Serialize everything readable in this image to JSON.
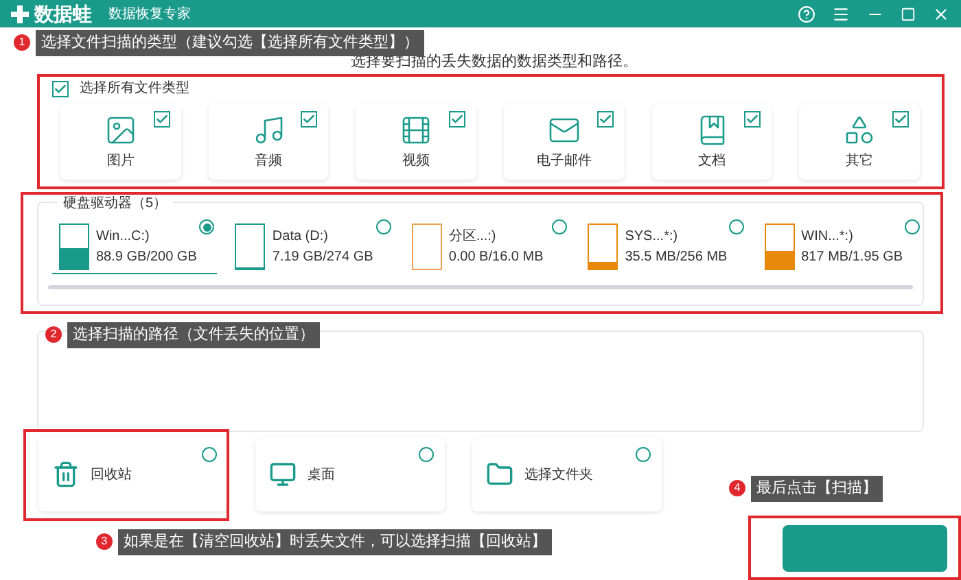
{
  "header": {
    "logo_text": "数据蛙",
    "subtitle": "数据恢复专家"
  },
  "heading": "选择要扫描的丢失数据的数据类型和路径。",
  "select_all": {
    "label": "选择所有文件类型",
    "checked": true
  },
  "file_types": [
    {
      "kind": "image",
      "label": "图片",
      "checked": true
    },
    {
      "kind": "audio",
      "label": "音频",
      "checked": true
    },
    {
      "kind": "video",
      "label": "视频",
      "checked": true
    },
    {
      "kind": "email",
      "label": "电子邮件",
      "checked": true
    },
    {
      "kind": "document",
      "label": "文档",
      "checked": true
    },
    {
      "kind": "other",
      "label": "其它",
      "checked": true
    }
  ],
  "drives": {
    "title": "硬盘驱动器（5）",
    "items": [
      {
        "name": "Win...C:)",
        "size": "88.9 GB/200 GB",
        "level": 0.45,
        "color": "#1a9a8a",
        "selected": true
      },
      {
        "name": "Data (D:)",
        "size": "7.19 GB/274 GB",
        "level": 0.03,
        "color": "#1a9a8a",
        "selected": false
      },
      {
        "name": "分区...:)",
        "size": "0.00  B/16.0 MB",
        "level": 0,
        "color": "#f0a050",
        "selected": false
      },
      {
        "name": "SYS...*:)",
        "size": "35.5 MB/256 MB",
        "level": 0.15,
        "color": "#e8890c",
        "selected": false
      },
      {
        "name": "WIN...*:)",
        "size": "817 MB/1.95 GB",
        "level": 0.42,
        "color": "#e8890c",
        "selected": false
      }
    ]
  },
  "locations": [
    {
      "kind": "recycle",
      "label": "回收站",
      "selected": false
    },
    {
      "kind": "desktop",
      "label": "桌面",
      "selected": false
    },
    {
      "kind": "folder",
      "label": "选择文件夹",
      "selected": false
    }
  ],
  "annotations": [
    {
      "number": "1",
      "text": "选择文件扫描的类型（建议勾选【选择所有文件类型】）"
    },
    {
      "number": "2",
      "text": "选择扫描的路径（文件丢失的位置）"
    },
    {
      "number": "3",
      "text": "如果是在【清空回收站】时丢失文件，可以选择扫描【回收站】"
    },
    {
      "number": "4",
      "text": "最后点击【扫描】"
    }
  ]
}
